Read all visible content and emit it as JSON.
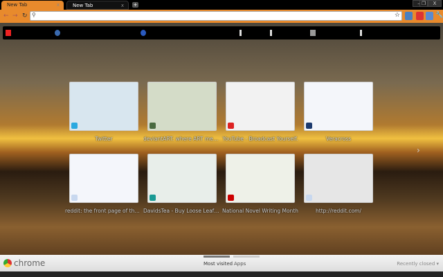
{
  "tabs": [
    {
      "label": "New Tab",
      "active": true
    },
    {
      "label": "New Tab",
      "active": false
    }
  ],
  "window": {
    "minimize": "–",
    "restore": "❐",
    "close": "X"
  },
  "omnibox": {
    "value": "",
    "placeholder": ""
  },
  "most_visited": [
    {
      "title": "Twitter",
      "thumb_color": "#d8e6ef",
      "fav": "#2aa9e0"
    },
    {
      "title": "deviantART: where ART meets ap...",
      "thumb_color": "#d4dcc8",
      "fav": "#4a6a40"
    },
    {
      "title": "YouTube - Broadcast Yourself.",
      "thumb_color": "#f2f2f2",
      "fav": "#d22"
    },
    {
      "title": "Veracross",
      "thumb_color": "#f4f6fa",
      "fav": "#1c3a6e"
    },
    {
      "title": "reddit: the front page of the inter...",
      "thumb_color": "#f4f6fb",
      "fav": "#c8d8ef"
    },
    {
      "title": "DavidsTea - Buy Loose Leaf Tea ...",
      "thumb_color": "#e8eeea",
      "fav": "#1a9a94"
    },
    {
      "title": "National Novel Writing Month",
      "thumb_color": "#eef1e8",
      "fav": "#c00"
    },
    {
      "title": "http://reddit.com/",
      "thumb_color": "#e6e6e6",
      "fav": "#c8d8ef"
    }
  ],
  "footer": {
    "brand": "chrome",
    "most_visited": "Most visited",
    "apps": "Apps",
    "recently_closed": "Recently closed ▾"
  },
  "next_arrow": "›"
}
